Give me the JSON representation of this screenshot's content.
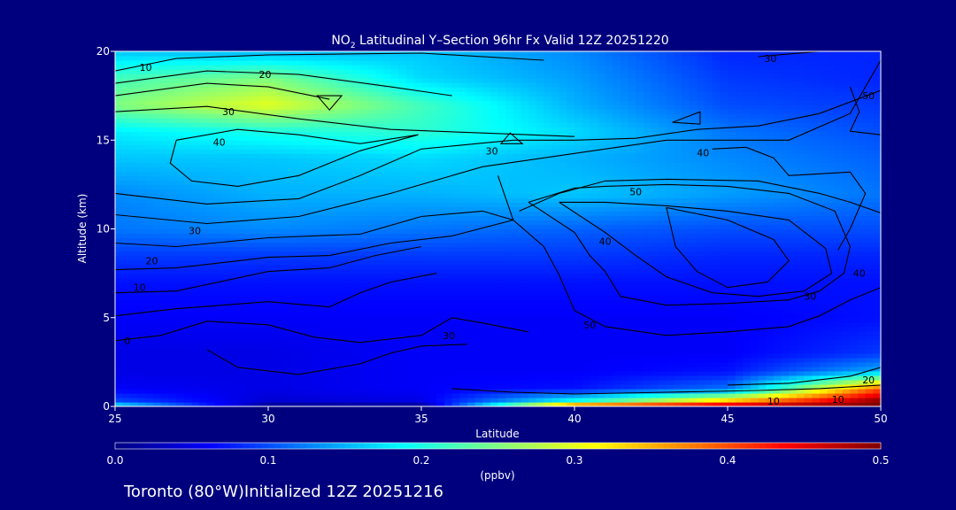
{
  "chart_data": {
    "type": "heatmap",
    "title_prefix": "NO",
    "title_sub": "2",
    "title_rest": " Latitudinal Y–Section 96hr  Fx Valid 12Z 20251220",
    "xlabel": "Latitude",
    "ylabel": "Altitude (km)",
    "xlim": [
      25,
      50
    ],
    "ylim": [
      0,
      20
    ],
    "xticks": [
      25,
      30,
      35,
      40,
      45,
      50
    ],
    "yticks": [
      0,
      5,
      10,
      15,
      20
    ],
    "colorbar": {
      "label": "(ppbv)",
      "range": [
        0.0,
        0.5
      ],
      "ticks": [
        "0.0",
        "0.1",
        "0.2",
        "0.3",
        "0.4",
        "0.5"
      ]
    },
    "field_knots": {
      "lat": [
        25,
        30,
        35,
        40,
        45,
        50
      ],
      "alt": [
        0,
        0.3,
        1,
        2,
        3,
        5,
        7,
        8.5,
        10,
        12,
        14,
        15.5,
        17,
        18.5,
        20
      ],
      "values": [
        [
          0.2,
          0.0,
          0.0,
          0.45,
          0.5,
          0.5
        ],
        [
          0.1,
          0.04,
          0.05,
          0.2,
          0.35,
          0.5
        ],
        [
          0.06,
          0.05,
          0.06,
          0.07,
          0.12,
          0.4
        ],
        [
          0.05,
          0.05,
          0.06,
          0.06,
          0.07,
          0.15
        ],
        [
          0.05,
          0.05,
          0.06,
          0.06,
          0.06,
          0.09
        ],
        [
          0.06,
          0.06,
          0.06,
          0.06,
          0.06,
          0.07
        ],
        [
          0.07,
          0.07,
          0.07,
          0.07,
          0.07,
          0.07
        ],
        [
          0.09,
          0.09,
          0.09,
          0.09,
          0.08,
          0.08
        ],
        [
          0.12,
          0.13,
          0.12,
          0.11,
          0.1,
          0.1
        ],
        [
          0.13,
          0.15,
          0.15,
          0.16,
          0.14,
          0.12
        ],
        [
          0.16,
          0.16,
          0.17,
          0.15,
          0.13,
          0.11
        ],
        [
          0.18,
          0.2,
          0.21,
          0.17,
          0.12,
          0.1
        ],
        [
          0.25,
          0.3,
          0.22,
          0.15,
          0.1,
          0.09
        ],
        [
          0.22,
          0.25,
          0.17,
          0.14,
          0.09,
          0.08
        ],
        [
          0.16,
          0.15,
          0.16,
          0.13,
          0.08,
          0.08
        ]
      ]
    },
    "contour_labels": [
      {
        "text": "10",
        "lat": 26.0,
        "alt": 19.1
      },
      {
        "text": "20",
        "lat": 29.9,
        "alt": 18.7
      },
      {
        "text": "30",
        "lat": 28.7,
        "alt": 16.6
      },
      {
        "text": "40",
        "lat": 28.4,
        "alt": 14.9
      },
      {
        "text": "30",
        "lat": 27.6,
        "alt": 9.9
      },
      {
        "text": "20",
        "lat": 26.2,
        "alt": 8.2
      },
      {
        "text": "10",
        "lat": 25.8,
        "alt": 6.7
      },
      {
        "text": "0",
        "lat": 25.4,
        "alt": 3.7
      },
      {
        "text": "30",
        "lat": 37.3,
        "alt": 14.4
      },
      {
        "text": "50",
        "lat": 42.0,
        "alt": 12.1
      },
      {
        "text": "40",
        "lat": 41.0,
        "alt": 9.3
      },
      {
        "text": "40",
        "lat": 44.2,
        "alt": 14.3
      },
      {
        "text": "30",
        "lat": 35.9,
        "alt": 4.0
      },
      {
        "text": "50",
        "lat": 40.5,
        "alt": 4.6
      },
      {
        "text": "30",
        "lat": 46.4,
        "alt": 19.6
      },
      {
        "text": "50",
        "lat": 49.6,
        "alt": 17.5
      },
      {
        "text": "40",
        "lat": 49.3,
        "alt": 7.5
      },
      {
        "text": "30",
        "lat": 47.7,
        "alt": 6.2
      },
      {
        "text": "20",
        "lat": 49.6,
        "alt": 1.5
      },
      {
        "text": "10",
        "lat": 46.5,
        "alt": 0.3
      },
      {
        "text": "10",
        "lat": 48.6,
        "alt": 0.4
      }
    ],
    "contours": [
      [
        [
          25,
          18.9
        ],
        [
          27,
          19.6
        ],
        [
          30,
          19.8
        ],
        [
          35,
          19.9
        ],
        [
          39,
          19.5
        ]
      ],
      [
        [
          25,
          18.2
        ],
        [
          28,
          18.9
        ],
        [
          31,
          18.7
        ],
        [
          34,
          18.0
        ],
        [
          36,
          17.5
        ]
      ],
      [
        [
          25,
          17.5
        ],
        [
          28,
          18.2
        ],
        [
          30,
          18.0
        ],
        [
          32,
          17.3
        ]
      ],
      [
        [
          25,
          16.6
        ],
        [
          28,
          16.9
        ],
        [
          31,
          16.2
        ],
        [
          34,
          15.6
        ],
        [
          37,
          15.4
        ],
        [
          40,
          15.2
        ]
      ],
      [
        [
          27,
          15.0
        ],
        [
          29,
          15.6
        ],
        [
          31,
          15.3
        ],
        [
          33,
          14.8
        ],
        [
          34.9,
          15.3
        ],
        [
          33,
          14.4
        ],
        [
          31,
          13.0
        ],
        [
          29,
          12.4
        ],
        [
          27.5,
          12.7
        ],
        [
          26.8,
          13.7
        ],
        [
          27,
          15.0
        ]
      ],
      [
        [
          25,
          12.0
        ],
        [
          28,
          11.4
        ],
        [
          31,
          11.7
        ],
        [
          33,
          13.0
        ],
        [
          35,
          14.5
        ],
        [
          38,
          15.0
        ],
        [
          40,
          15.0
        ],
        [
          42,
          15.1
        ],
        [
          44,
          15.6
        ],
        [
          46,
          15.8
        ],
        [
          48,
          16.5
        ],
        [
          50,
          17.8
        ]
      ],
      [
        [
          25,
          10.8
        ],
        [
          28,
          10.3
        ],
        [
          31,
          10.7
        ],
        [
          34,
          12.0
        ],
        [
          37,
          13.5
        ],
        [
          39,
          14.0
        ],
        [
          41,
          14.5
        ],
        [
          43,
          15.0
        ],
        [
          45,
          15.0
        ],
        [
          47,
          15.0
        ],
        [
          49,
          16.5
        ],
        [
          50,
          19.5
        ]
      ],
      [
        [
          25,
          9.2
        ],
        [
          27,
          9.0
        ],
        [
          30,
          9.5
        ],
        [
          33,
          9.7
        ],
        [
          35,
          10.7
        ],
        [
          37,
          11.0
        ],
        [
          38,
          10.5
        ]
      ],
      [
        [
          25,
          7.7
        ],
        [
          27,
          7.8
        ],
        [
          30,
          8.4
        ],
        [
          32,
          8.5
        ],
        [
          34,
          9.2
        ],
        [
          36,
          9.6
        ],
        [
          38,
          10.5
        ]
      ],
      [
        [
          25,
          6.4
        ],
        [
          27,
          6.5
        ],
        [
          30,
          7.6
        ],
        [
          32,
          7.8
        ],
        [
          33.5,
          8.5
        ],
        [
          35,
          9.0
        ]
      ],
      [
        [
          25,
          5.1
        ],
        [
          27,
          5.5
        ],
        [
          30,
          5.9
        ],
        [
          32,
          5.6
        ],
        [
          33,
          6.4
        ],
        [
          34,
          7.0
        ],
        [
          35.5,
          7.5
        ]
      ],
      [
        [
          25,
          3.7
        ],
        [
          26.5,
          4.0
        ],
        [
          28,
          4.8
        ],
        [
          30,
          4.6
        ],
        [
          31.5,
          3.9
        ],
        [
          33,
          3.6
        ],
        [
          35,
          4.0
        ],
        [
          36,
          5.0
        ],
        [
          37,
          4.7
        ],
        [
          38.5,
          4.2
        ]
      ],
      [
        [
          28,
          3.2
        ],
        [
          29,
          2.2
        ],
        [
          31,
          1.8
        ],
        [
          33,
          2.4
        ],
        [
          34,
          3.0
        ],
        [
          35,
          3.4
        ],
        [
          36.5,
          3.5
        ]
      ],
      [
        [
          37.5,
          13.0
        ],
        [
          38,
          10.5
        ],
        [
          39,
          9.0
        ],
        [
          39.5,
          7.4
        ],
        [
          40,
          5.4
        ],
        [
          41,
          4.5
        ],
        [
          43,
          4.0
        ],
        [
          45,
          4.2
        ],
        [
          47,
          4.5
        ],
        [
          48,
          5.1
        ],
        [
          49,
          6.0
        ],
        [
          50,
          6.7
        ]
      ],
      [
        [
          38.2,
          11.0
        ],
        [
          39.5,
          12.0
        ],
        [
          41,
          12.7
        ],
        [
          43,
          12.8
        ],
        [
          46,
          12.7
        ],
        [
          48,
          12.0
        ],
        [
          49,
          11.5
        ],
        [
          50,
          10.9
        ]
      ],
      [
        [
          38.5,
          11.5
        ],
        [
          40,
          12.3
        ],
        [
          41,
          12.4
        ],
        [
          43,
          12.5
        ],
        [
          45,
          12.4
        ],
        [
          47,
          12.0
        ],
        [
          48.5,
          11.0
        ],
        [
          49,
          9.0
        ],
        [
          48.8,
          7.5
        ],
        [
          48,
          6.5
        ],
        [
          47,
          6.0
        ],
        [
          45,
          5.8
        ],
        [
          43,
          5.7
        ],
        [
          41.5,
          6.2
        ],
        [
          41,
          7.6
        ],
        [
          40.5,
          8.5
        ],
        [
          40,
          9.8
        ],
        [
          38.5,
          11.5
        ]
      ],
      [
        [
          39.5,
          11.5
        ],
        [
          41,
          11.5
        ],
        [
          43,
          11.3
        ],
        [
          45,
          11.0
        ],
        [
          47,
          10.5
        ],
        [
          48.2,
          8.9
        ],
        [
          48.4,
          7.5
        ],
        [
          47.5,
          6.5
        ],
        [
          46,
          6.2
        ],
        [
          44.5,
          6.4
        ],
        [
          43,
          7.3
        ],
        [
          42,
          8.5
        ],
        [
          41,
          9.8
        ],
        [
          39.5,
          11.5
        ]
      ],
      [
        [
          43,
          11.2
        ],
        [
          45,
          10.5
        ],
        [
          46.5,
          9.4
        ],
        [
          47,
          8.2
        ],
        [
          46.3,
          7.0
        ],
        [
          45,
          6.7
        ],
        [
          44,
          7.6
        ],
        [
          43.3,
          9.0
        ],
        [
          43,
          11.2
        ]
      ],
      [
        [
          44.5,
          14.5
        ],
        [
          45.6,
          14.6
        ],
        [
          46.5,
          14.0
        ],
        [
          47,
          13.0
        ],
        [
          49,
          13.2
        ],
        [
          49.5,
          12.0
        ],
        [
          49,
          10.0
        ],
        [
          48.6,
          8.8
        ]
      ],
      [
        [
          46,
          19.7
        ],
        [
          48,
          20.0
        ]
      ],
      [
        [
          49,
          18.0
        ],
        [
          49.3,
          16.6
        ],
        [
          49,
          15.5
        ],
        [
          50,
          15.3
        ]
      ],
      [
        [
          36,
          1.0
        ],
        [
          38,
          0.8
        ],
        [
          40,
          0.7
        ],
        [
          43,
          0.8
        ],
        [
          46,
          0.9
        ],
        [
          48,
          1.0
        ],
        [
          50,
          1.2
        ]
      ],
      [
        [
          45,
          1.2
        ],
        [
          47,
          1.3
        ],
        [
          49,
          1.7
        ],
        [
          50,
          2.2
        ]
      ]
    ],
    "triangles": [
      [
        [
          31.6,
          17.5
        ],
        [
          32.4,
          17.5
        ],
        [
          32.0,
          16.7
        ]
      ],
      [
        [
          37.6,
          14.8
        ],
        [
          38.3,
          14.8
        ],
        [
          37.9,
          15.4
        ]
      ],
      [
        [
          43.2,
          16.0
        ],
        [
          44.1,
          16.6
        ],
        [
          44.1,
          15.9
        ]
      ]
    ]
  },
  "footer": {
    "text": "Toronto (80°W)Initialized 12Z 20251216"
  }
}
